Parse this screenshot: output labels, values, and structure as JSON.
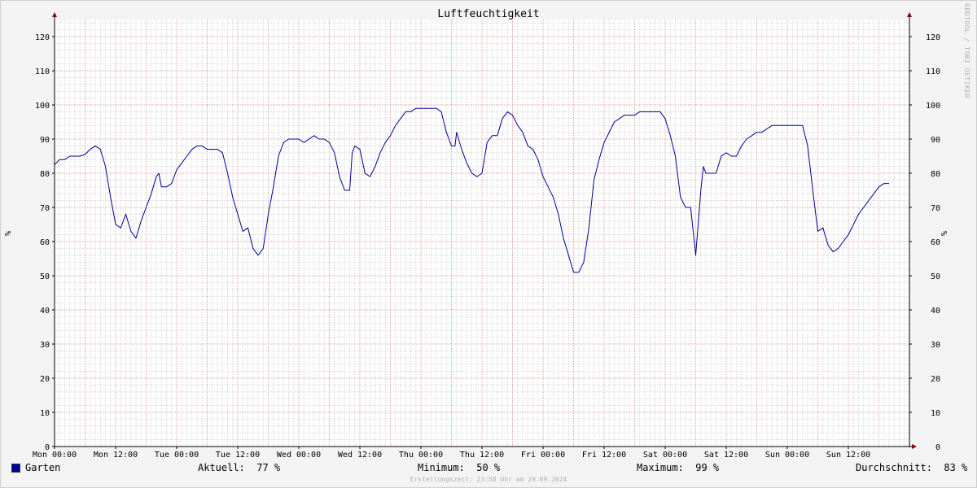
{
  "chart_data": {
    "type": "line",
    "title": "Luftfeuchtigkeit",
    "ylabel": "%",
    "ylim": [
      0,
      125
    ],
    "yticks": [
      0,
      10,
      20,
      30,
      40,
      50,
      60,
      70,
      80,
      90,
      100,
      110,
      120
    ],
    "xlim": [
      0,
      168
    ],
    "xticks": [
      {
        "t": 0,
        "label": "Mon 00:00"
      },
      {
        "t": 12,
        "label": "Mon 12:00"
      },
      {
        "t": 24,
        "label": "Tue 00:00"
      },
      {
        "t": 36,
        "label": "Tue 12:00"
      },
      {
        "t": 48,
        "label": "Wed 00:00"
      },
      {
        "t": 60,
        "label": "Wed 12:00"
      },
      {
        "t": 72,
        "label": "Thu 00:00"
      },
      {
        "t": 84,
        "label": "Thu 12:00"
      },
      {
        "t": 96,
        "label": "Fri 00:00"
      },
      {
        "t": 108,
        "label": "Fri 12:00"
      },
      {
        "t": 120,
        "label": "Sat 00:00"
      },
      {
        "t": 132,
        "label": "Sat 12:00"
      },
      {
        "t": 144,
        "label": "Sun 00:00"
      },
      {
        "t": 156,
        "label": "Sun 12:00"
      }
    ],
    "grid": true,
    "series": [
      {
        "name": "Garten",
        "color": "#000099",
        "points": [
          [
            0,
            82.5
          ],
          [
            1,
            84
          ],
          [
            2,
            84
          ],
          [
            3,
            85
          ],
          [
            4,
            85
          ],
          [
            5,
            85
          ],
          [
            6,
            85.5
          ],
          [
            7,
            87
          ],
          [
            8,
            88
          ],
          [
            9,
            87
          ],
          [
            10,
            82
          ],
          [
            11,
            73
          ],
          [
            12,
            65
          ],
          [
            13,
            64
          ],
          [
            14,
            68
          ],
          [
            15,
            63
          ],
          [
            16,
            61
          ],
          [
            17,
            66
          ],
          [
            18,
            70
          ],
          [
            19,
            74
          ],
          [
            20,
            79
          ],
          [
            20.5,
            80
          ],
          [
            21,
            76
          ],
          [
            22,
            76
          ],
          [
            23,
            77
          ],
          [
            24,
            81
          ],
          [
            25,
            83
          ],
          [
            26,
            85
          ],
          [
            27,
            87
          ],
          [
            28,
            88
          ],
          [
            29,
            88
          ],
          [
            30,
            87
          ],
          [
            31,
            87
          ],
          [
            32,
            87
          ],
          [
            33,
            86
          ],
          [
            34,
            80
          ],
          [
            35,
            73
          ],
          [
            36,
            68
          ],
          [
            37,
            63
          ],
          [
            38,
            64
          ],
          [
            39,
            58
          ],
          [
            40,
            56
          ],
          [
            41,
            58
          ],
          [
            42,
            68
          ],
          [
            43,
            76
          ],
          [
            44,
            85
          ],
          [
            45,
            89
          ],
          [
            46,
            90
          ],
          [
            47,
            90
          ],
          [
            48,
            90
          ],
          [
            49,
            89
          ],
          [
            50,
            90
          ],
          [
            51,
            91
          ],
          [
            52,
            90
          ],
          [
            53,
            90
          ],
          [
            54,
            89
          ],
          [
            55,
            86
          ],
          [
            56,
            79
          ],
          [
            57,
            75
          ],
          [
            58,
            75
          ],
          [
            58.5,
            86
          ],
          [
            59,
            88
          ],
          [
            60,
            87
          ],
          [
            61,
            80
          ],
          [
            62,
            79
          ],
          [
            63,
            82
          ],
          [
            64,
            86
          ],
          [
            65,
            89
          ],
          [
            66,
            91
          ],
          [
            67,
            94
          ],
          [
            68,
            96
          ],
          [
            69,
            98
          ],
          [
            70,
            98
          ],
          [
            71,
            99
          ],
          [
            72,
            99
          ],
          [
            73,
            99
          ],
          [
            74,
            99
          ],
          [
            75,
            99
          ],
          [
            76,
            98
          ],
          [
            77,
            92
          ],
          [
            78,
            88
          ],
          [
            78.7,
            88
          ],
          [
            79,
            92
          ],
          [
            80,
            87
          ],
          [
            81,
            83
          ],
          [
            82,
            80
          ],
          [
            83,
            79
          ],
          [
            84,
            80
          ],
          [
            85,
            89
          ],
          [
            86,
            91
          ],
          [
            87,
            91
          ],
          [
            88,
            96
          ],
          [
            89,
            98
          ],
          [
            90,
            97
          ],
          [
            91,
            94
          ],
          [
            92,
            92
          ],
          [
            93,
            88
          ],
          [
            94,
            87
          ],
          [
            95,
            84
          ],
          [
            96,
            79
          ],
          [
            97,
            76
          ],
          [
            98,
            73
          ],
          [
            99,
            68
          ],
          [
            100,
            61
          ],
          [
            101,
            56
          ],
          [
            102,
            51
          ],
          [
            103,
            51
          ],
          [
            104,
            54
          ],
          [
            105,
            64
          ],
          [
            106,
            78
          ],
          [
            107,
            84
          ],
          [
            108,
            89
          ],
          [
            109,
            92
          ],
          [
            110,
            95
          ],
          [
            111,
            96
          ],
          [
            112,
            97
          ],
          [
            113,
            97
          ],
          [
            114,
            97
          ],
          [
            115,
            98
          ],
          [
            116,
            98
          ],
          [
            117,
            98
          ],
          [
            118,
            98
          ],
          [
            119,
            98
          ],
          [
            120,
            96
          ],
          [
            121,
            91
          ],
          [
            122,
            85
          ],
          [
            123,
            73
          ],
          [
            124,
            70
          ],
          [
            125,
            70
          ],
          [
            126,
            56
          ],
          [
            127,
            75
          ],
          [
            127.5,
            82
          ],
          [
            128,
            80
          ],
          [
            129,
            80
          ],
          [
            130,
            80
          ],
          [
            131,
            85
          ],
          [
            132,
            86
          ],
          [
            133,
            85
          ],
          [
            134,
            85
          ],
          [
            135,
            88
          ],
          [
            136,
            90
          ],
          [
            137,
            91
          ],
          [
            138,
            92
          ],
          [
            139,
            92
          ],
          [
            140,
            93
          ],
          [
            141,
            94
          ],
          [
            142,
            94
          ],
          [
            143,
            94
          ],
          [
            144,
            94
          ],
          [
            145,
            94
          ],
          [
            146,
            94
          ],
          [
            147,
            94
          ],
          [
            148,
            88
          ],
          [
            149,
            75
          ],
          [
            150,
            63
          ],
          [
            151,
            64
          ],
          [
            152,
            59
          ],
          [
            153,
            57
          ],
          [
            154,
            58
          ],
          [
            155,
            60
          ],
          [
            156,
            62
          ],
          [
            157,
            65
          ],
          [
            158,
            68
          ],
          [
            159,
            70
          ],
          [
            160,
            72
          ],
          [
            161,
            74
          ],
          [
            162,
            76
          ],
          [
            163,
            77
          ],
          [
            164,
            77
          ]
        ]
      }
    ]
  },
  "legend": {
    "series_name": "Garten",
    "current_label": "Aktuell:",
    "current_value": "77 %",
    "min_label": "Minimum:",
    "min_value": "50 %",
    "max_label": "Maximum:",
    "max_value": "99 %",
    "avg_label": "Durchschnitt:",
    "avg_value": "83 %"
  },
  "watermark": "RRDTOOL / TOBI OETIKER",
  "footer": "Erstellungszeit: 23:58 Uhr am 29.09.2024",
  "colors": {
    "line": "#000099",
    "major_grid": "#e8a0a0",
    "minor_grid": "#d7d7d7",
    "axis": "#000000",
    "arrow": "#8b0000",
    "plot_bg": "#ffffff",
    "page_bg": "#f3f3f3"
  }
}
